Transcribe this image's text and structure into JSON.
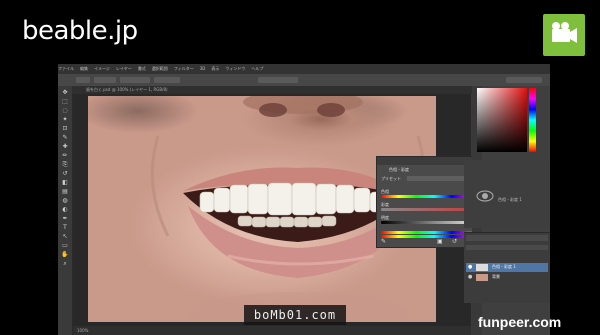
{
  "site": {
    "logo_text": "beable.jp",
    "watermark_bottom": "boMb01.com",
    "watermark_right": "funpeer.com"
  },
  "badge": {
    "icon": "video-camera-icon",
    "color": "#7ec03c"
  },
  "photoshop": {
    "menu": [
      "ファイル",
      "編集",
      "イメージ",
      "レイヤー",
      "書式",
      "選択範囲",
      "フィルター",
      "3D",
      "表示",
      "ウィンドウ",
      "ヘルプ"
    ],
    "tab_title": "歯を白く.psd @ 100% (レイヤー 1, RGB/8)",
    "status_text": "100%",
    "tools": [
      "move-tool-icon",
      "marquee-tool-icon",
      "lasso-tool-icon",
      "quick-select-tool-icon",
      "crop-tool-icon",
      "eyedropper-tool-icon",
      "healing-brush-tool-icon",
      "brush-tool-icon",
      "clone-stamp-tool-icon",
      "history-brush-tool-icon",
      "eraser-tool-icon",
      "gradient-tool-icon",
      "blur-tool-icon",
      "dodge-tool-icon",
      "pen-tool-icon",
      "type-tool-icon",
      "path-select-tool-icon",
      "shape-tool-icon",
      "hand-tool-icon",
      "zoom-tool-icon"
    ],
    "float_panel": {
      "title": "色相・彩度",
      "preset_label": "プリセット",
      "hue_label": "色相",
      "saturation_label": "彩度",
      "lightness_label": "明度",
      "hue_value": "0",
      "saturation_value": "-48",
      "lightness_value": "0"
    },
    "adjustments_label": "色相・彩度 1",
    "layers": [
      {
        "name": "色相・彩度 1",
        "selected": true
      },
      {
        "name": "背景",
        "selected": false
      }
    ],
    "accent_color": "#4f76a4"
  }
}
